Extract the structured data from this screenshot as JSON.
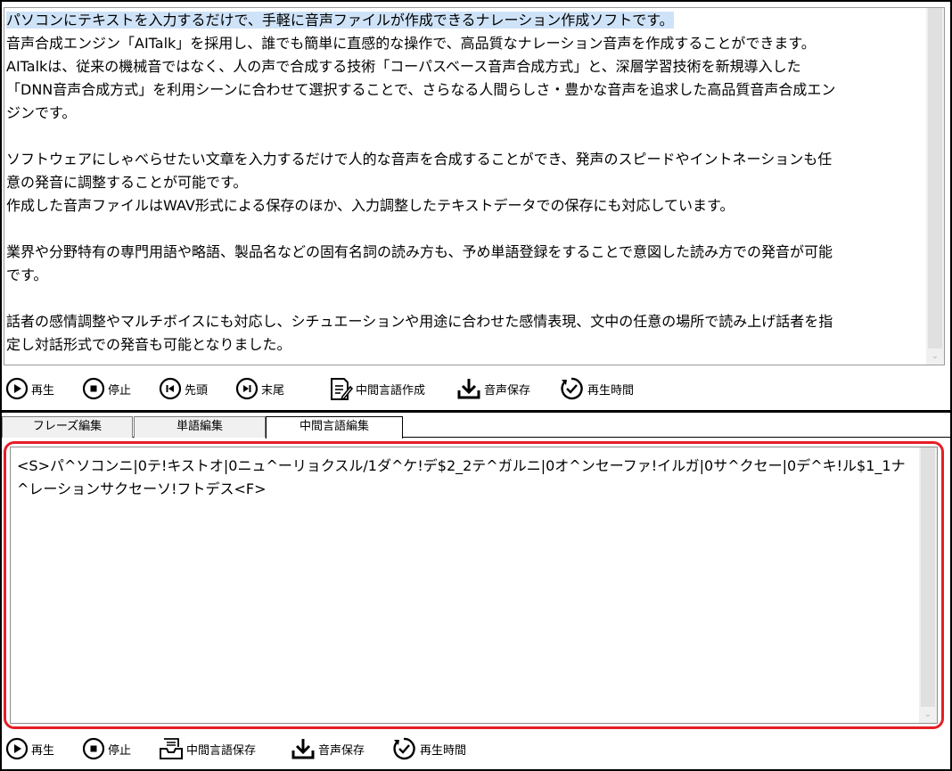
{
  "main_text": {
    "selected_line": "パソコンにテキストを入力するだけで、手軽に音声ファイルが作成できるナレーション作成ソフトです。",
    "lines": [
      "音声合成エンジン「AITalk」を採用し、誰でも簡単に直感的な操作で、高品質なナレーション音声を作成することができます。",
      "AITalkは、従来の機械音ではなく、人の声で合成する技術「コーパスベース音声合成方式」と、深層学習技術を新規導入した",
      "「DNN音声合成方式」を利用シーンに合わせて選択することで、さらなる人間らしさ・豊かな音声を追求した高品質音声合成エン",
      "ジンです。",
      "",
      "ソフトウェアにしゃべらせたい文章を入力するだけで人的な音声を合成することができ、発声のスピードやイントネーションも任",
      "意の発音に調整することが可能です。",
      "作成した音声ファイルはWAV形式による保存のほか、入力調整したテキストデータでの保存にも対応しています。",
      "",
      "業界や分野特有の専門用語や略語、製品名などの固有名詞の読み方も、予め単語登録をすることで意図した読み方での発音が可能",
      "です。",
      "",
      "話者の感情調整やマルチボイスにも対応し、シチュエーションや用途に合わせた感情表現、文中の任意の場所で読み上げ話者を指",
      "定し対話形式での発音も可能となりました。"
    ]
  },
  "top_toolbar": {
    "play": "再生",
    "stop": "停止",
    "first": "先頭",
    "last": "末尾",
    "create_intermediate": "中間言語作成",
    "save_audio": "音声保存",
    "play_time": "再生時間"
  },
  "tabs": [
    "フレーズ編集",
    "単語編集",
    "中間言語編集"
  ],
  "active_tab": "中間言語編集",
  "intermediate_text": "<S>パ^ソコンニ|0テ!キストオ|0ニュ^ーリョクスル/1ダ^ケ!デ$2_2テ^ガルニ|0オ^ンセーファ!イルガ|0サ^クセー|0デ^キ!ル$1_1ナ^レーションサクセーソ!フトデス<F>",
  "bottom_toolbar": {
    "play": "再生",
    "stop": "停止",
    "save_intermediate": "中間言語保存",
    "save_audio": "音声保存",
    "play_time": "再生時間"
  },
  "colors": {
    "selection": "#cfe3f8",
    "highlight_border": "#e61e28"
  }
}
